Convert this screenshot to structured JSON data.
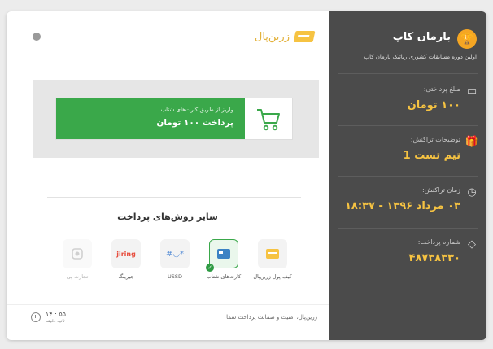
{
  "sidebar": {
    "title": "بارمان کاپ",
    "subtitle": "اولین دوره مسابقات کشوری رباتیک بارمان کاپ",
    "fields": [
      {
        "label": "مبلغ پرداختی:",
        "value": "۱۰۰ تومان",
        "icon": "wallet-icon"
      },
      {
        "label": "توضیحات تراکنش:",
        "value": "تیم تست 1",
        "icon": "gift-icon"
      },
      {
        "label": "زمان تراکنش:",
        "value": "۰۳ مرداد ۱۳۹۶ - ۱۸:۳۷",
        "icon": "clock-icon"
      },
      {
        "label": "شماره پرداخت:",
        "value": "۴۸۷۳۸۳۳۰",
        "icon": "tag-icon"
      }
    ],
    "colors": {
      "bg": "#4b4b4b",
      "value": "#f6c342"
    }
  },
  "main": {
    "brand": "زرین‌پال",
    "card_payment": {
      "small": "واریز از طریق کارت‌های شتاب",
      "big": "پرداخت ۱۰۰ تومان"
    },
    "other_title": "سایر روش‌های پرداخت",
    "methods": [
      {
        "label": "کیف پول زرین‌پال",
        "icon": "wallet-icon"
      },
      {
        "label": "کارت‌های شتاب",
        "icon": "card-icon",
        "selected": true
      },
      {
        "label": "USSD",
        "icon": "ussd-icon"
      },
      {
        "label": "جیرینگ",
        "icon": "jiring-logo"
      },
      {
        "label": "تجارت پی",
        "icon": "tejarat-icon",
        "disabled": true
      }
    ],
    "footer": "زرین‌پال، امنیت و ضمانت پرداخت شما",
    "timer": {
      "value": "۱۴ : ۵۵",
      "sub": "ثانیه  دقیقه"
    }
  },
  "colors": {
    "accent": "#3aa84a",
    "brand": "#f6c342"
  }
}
